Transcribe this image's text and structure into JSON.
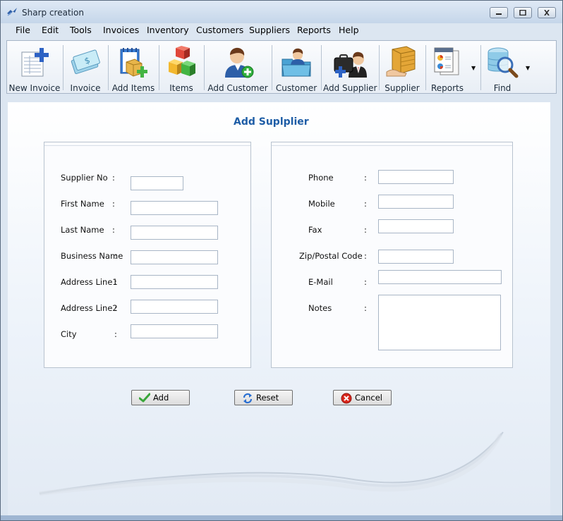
{
  "window": {
    "title": "Sharp creation",
    "controls": [
      "minimize",
      "maximize",
      "close"
    ]
  },
  "menu": [
    {
      "label": "File"
    },
    {
      "label": "Edit"
    },
    {
      "label": "Tools"
    },
    {
      "label": "Invoices"
    },
    {
      "label": "Inventory"
    },
    {
      "label": "Customers"
    },
    {
      "label": "Suppliers"
    },
    {
      "label": "Reports"
    },
    {
      "label": "Help"
    }
  ],
  "toolbar": [
    {
      "label": "New Invoice",
      "icon": "new-invoice-icon"
    },
    {
      "label": "Invoice",
      "icon": "invoice-icon"
    },
    {
      "label": "Add Items",
      "icon": "add-items-icon"
    },
    {
      "label": "Items",
      "icon": "items-icon"
    },
    {
      "label": "Add Customer",
      "icon": "add-customer-icon"
    },
    {
      "label": "Customer",
      "icon": "customer-icon"
    },
    {
      "label": "Add Supplier",
      "icon": "add-supplier-icon"
    },
    {
      "label": "Supplier",
      "icon": "supplier-icon"
    },
    {
      "label": "Reports",
      "icon": "reports-icon",
      "dropdown": true
    },
    {
      "label": "Find",
      "icon": "find-icon",
      "dropdown": true
    }
  ],
  "form": {
    "title": "Add Suplplier",
    "left_fields": [
      {
        "label": "Supplier No",
        "colon": ":",
        "value": ""
      },
      {
        "label": "First Name",
        "colon": ":",
        "value": ""
      },
      {
        "label": "Last Name",
        "colon": ":",
        "value": ""
      },
      {
        "label": "Business Name",
        "colon": ":",
        "value": ""
      },
      {
        "label": "Address Line1",
        "colon": ":",
        "value": ""
      },
      {
        "label": "Address Line2",
        "colon": ":",
        "value": ""
      },
      {
        "label": "City",
        "colon": ":",
        "value": ""
      }
    ],
    "right_fields": [
      {
        "label": "Phone",
        "colon": ":",
        "value": ""
      },
      {
        "label": "Mobile",
        "colon": ":",
        "value": ""
      },
      {
        "label": "Fax",
        "colon": ":",
        "value": ""
      },
      {
        "label": "Zip/Postal Code",
        "colon": ":",
        "value": ""
      },
      {
        "label": "E-Mail",
        "colon": ":",
        "value": ""
      },
      {
        "label": "Notes",
        "colon": ":",
        "value": ""
      }
    ]
  },
  "buttons": {
    "add": "Add",
    "reset": "Reset",
    "cancel": "Cancel"
  },
  "colors": {
    "title_text": "#1e5da6",
    "window_frame": "#dce6f1",
    "panel_border": "#b8c3cf",
    "add_check": "#3aa63a",
    "reset_arrows": "#2a6fd1",
    "cancel_red": "#d9261c"
  }
}
